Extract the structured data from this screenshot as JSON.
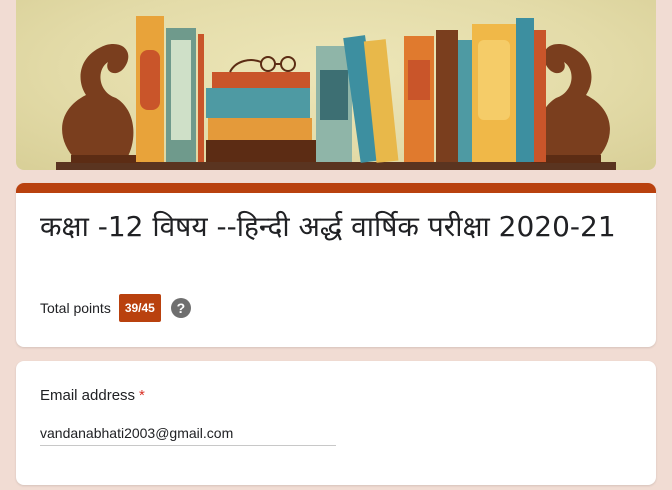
{
  "header": {
    "banner_image": "bookshelf-banner-illustration"
  },
  "form": {
    "title": "कक्षा -12 विषय --हिन्दी अर्द्ध वार्षिक परीक्षा 2020-21",
    "points_label": "Total points",
    "points_value": "39/45",
    "help_icon": "?"
  },
  "email": {
    "label": "Email address",
    "required_marker": "*",
    "value": "vandanabhati2003@gmail.com"
  },
  "colors": {
    "accent": "#b9410e",
    "background": "#f1dcd3",
    "required": "#d93025"
  }
}
